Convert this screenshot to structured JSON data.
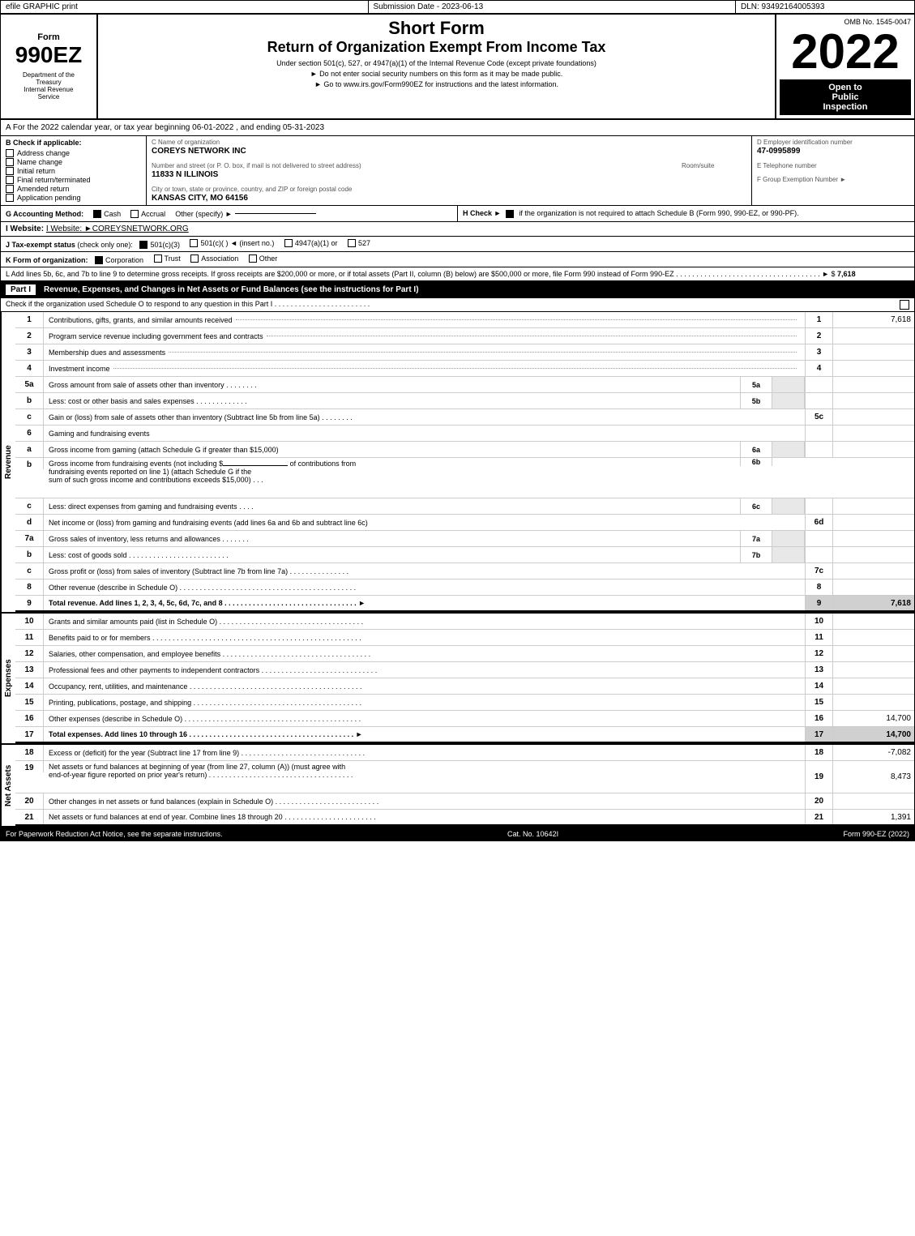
{
  "header": {
    "efile_label": "efile GRAPHIC print",
    "submission_label": "Submission Date - 2023-06-13",
    "dln_label": "DLN: 93492164005393"
  },
  "form": {
    "number": "990EZ",
    "dept_line1": "Department of the",
    "dept_line2": "Treasury",
    "dept_line3": "Internal Revenue",
    "dept_line4": "Service",
    "title1": "Short Form",
    "title2": "Return of Organization Exempt From Income Tax",
    "subtitle": "Under section 501(c), 527, or 4947(a)(1) of the Internal Revenue Code (except private foundations)",
    "instruction1": "► Do not enter social security numbers on this form as it may be made public.",
    "instruction2": "► Go to www.irs.gov/Form990EZ for instructions and the latest information.",
    "omb": "OMB No. 1545-0047",
    "year": "2022",
    "open_public": "Open to\nPublic\nInspection"
  },
  "section_a": {
    "label": "A  For the 2022 calendar year, or tax year beginning 06-01-2022 , and ending 05-31-2023"
  },
  "section_b": {
    "label": "B  Check if applicable:",
    "checkboxes": [
      {
        "id": "address_change",
        "label": "Address change",
        "checked": false
      },
      {
        "id": "name_change",
        "label": "Name change",
        "checked": false
      },
      {
        "id": "initial_return",
        "label": "Initial return",
        "checked": false
      },
      {
        "id": "final_return",
        "label": "Final return/terminated",
        "checked": false
      },
      {
        "id": "amended_return",
        "label": "Amended return",
        "checked": false
      },
      {
        "id": "application_pending",
        "label": "Application pending",
        "checked": false
      }
    ]
  },
  "section_c": {
    "name_label": "C Name of organization",
    "name_value": "COREYS NETWORK INC",
    "address_label": "Number and street (or P. O. box, if mail is not delivered to street address)",
    "address_value": "11833 N ILLINOIS",
    "room_label": "Room/suite",
    "room_value": "",
    "city_label": "City or town, state or province, country, and ZIP or foreign postal code",
    "city_value": "KANSAS CITY, MO  64156"
  },
  "section_d": {
    "label": "D Employer identification number",
    "value": "47-0995899",
    "tel_label": "E Telephone number",
    "tel_value": "",
    "group_label": "F Group Exemption",
    "group_sub": "Number  ►",
    "group_value": ""
  },
  "section_g": {
    "label": "G Accounting Method:",
    "cash_label": "Cash",
    "cash_checked": true,
    "accrual_label": "Accrual",
    "accrual_checked": false,
    "other_label": "Other (specify) ►",
    "other_value": ""
  },
  "section_h": {
    "label": "H  Check ►",
    "check_label": "if the organization is not required to attach Schedule B (Form 990, 990-EZ, or 990-PF).",
    "checked": true
  },
  "section_i": {
    "label": "I Website: ►COREYSNETWORK.ORG"
  },
  "section_j": {
    "label": "J Tax-exempt status (check only one):",
    "c3_checked": true,
    "c3_label": "501(c)(3)",
    "ct_checked": false,
    "ct_label": "501(c)(  )",
    "insert_label": "◄ (insert no.)",
    "c4947_checked": false,
    "c4947_label": "4947(a)(1) or",
    "c527_checked": false,
    "c527_label": "527"
  },
  "section_k": {
    "label": "K Form of organization:",
    "corp_checked": true,
    "corp_label": "Corporation",
    "trust_checked": false,
    "trust_label": "Trust",
    "assoc_checked": false,
    "assoc_label": "Association",
    "other_checked": false,
    "other_label": "Other"
  },
  "section_l": {
    "text": "L Add lines 5b, 6c, and 7b to line 9 to determine gross receipts. If gross receipts are $200,000 or more, or if total assets (Part II, column (B) below) are $500,000 or more, file Form 990 instead of Form 990-EZ . . . . . . . . . . . . . . . . . . . . . . . . . . . . . . . . . . . . ► $",
    "value": "7,618"
  },
  "part1": {
    "label": "Part I",
    "title": "Revenue, Expenses, and Changes in Net Assets or Fund Balances (see the instructions for Part I)",
    "check_note": "Check if the organization used Schedule O to respond to any question in this Part I . . . . . . . . . . . . . . . . . . . . . . . .",
    "rows": [
      {
        "num": "1",
        "desc": "Contributions, gifts, grants, and similar amounts received . . . . . . . . . . . . . . . . . . . . . . . . . . . . . . . .",
        "line": "1",
        "value": "7,618",
        "bold": false,
        "shaded": false
      },
      {
        "num": "2",
        "desc": "Program service revenue including government fees and contracts . . . . . . . . . . . . . . . . . . . . . . . . . . . . .",
        "line": "2",
        "value": "",
        "bold": false,
        "shaded": false
      },
      {
        "num": "3",
        "desc": "Membership dues and assessments . . . . . . . . . . . . . . . . . . . . . . . . . . . . . . . . . . . . . . . . . . . . . . . .",
        "line": "3",
        "value": "",
        "bold": false,
        "shaded": false
      },
      {
        "num": "4",
        "desc": "Investment income . . . . . . . . . . . . . . . . . . . . . . . . . . . . . . . . . . . . . . . . . . . . . . . . . . . . . . . . . . . .",
        "line": "4",
        "value": "",
        "bold": false,
        "shaded": false
      },
      {
        "num": "5a",
        "desc": "Gross amount from sale of assets other than inventory . . . . . . . .",
        "box_label": "5a",
        "line": "",
        "value": "",
        "has_box": true,
        "bold": false,
        "shaded": false
      },
      {
        "num": "b",
        "desc": "Less: cost or other basis and sales expenses . . . . . . . . . . . . .",
        "box_label": "5b",
        "line": "",
        "value": "",
        "has_box": true,
        "bold": false,
        "shaded": false
      },
      {
        "num": "c",
        "desc": "Gain or (loss) from sale of assets other than inventory (Subtract line 5b from line 5a) . . . . . . . .",
        "line": "5c",
        "value": "",
        "bold": false,
        "shaded": false
      },
      {
        "num": "6",
        "desc": "Gaming and fundraising events",
        "line": "",
        "value": "",
        "bold": false,
        "shaded": false,
        "no_dots": true
      },
      {
        "num": "a",
        "desc": "Gross income from gaming (attach Schedule G if greater than $15,000)",
        "box_label": "6a",
        "line": "",
        "value": "",
        "has_box": true,
        "bold": false,
        "shaded": false
      },
      {
        "num": "b",
        "desc": "Gross income from fundraising events (not including $________ of contributions from fundraising events reported on line 1) (attach Schedule G if the sum of such gross income and contributions exceeds $15,000) . . .",
        "box_label": "6b",
        "line": "",
        "value": "",
        "has_box": true,
        "bold": false,
        "shaded": false,
        "multiline": true
      },
      {
        "num": "c",
        "desc": "Less: direct expenses from gaming and fundraising events . . . .",
        "box_label": "6c",
        "line": "",
        "value": "",
        "has_box": true,
        "bold": false,
        "shaded": false
      },
      {
        "num": "d",
        "desc": "Net income or (loss) from gaming and fundraising events (add lines 6a and 6b and subtract line 6c)",
        "line": "6d",
        "value": "",
        "bold": false,
        "shaded": false
      },
      {
        "num": "7a",
        "desc": "Gross sales of inventory, less returns and allowances . . . . . . .",
        "box_label": "7a",
        "line": "",
        "value": "",
        "has_box": true,
        "bold": false,
        "shaded": false
      },
      {
        "num": "b",
        "desc": "Less: cost of goods sold . . . . . . . . . . . . . . . . . . . . . . . . . .",
        "box_label": "7b",
        "line": "",
        "value": "",
        "has_box": true,
        "bold": false,
        "shaded": false
      },
      {
        "num": "c",
        "desc": "Gross profit or (loss) from sales of inventory (Subtract line 7b from line 7a) . . . . . . . . . . . . . . .",
        "line": "7c",
        "value": "",
        "bold": false,
        "shaded": false
      },
      {
        "num": "8",
        "desc": "Other revenue (describe in Schedule O) . . . . . . . . . . . . . . . . . . . . . . . . . . . . . . . . . . . . . . . . . . . . .",
        "line": "8",
        "value": "",
        "bold": false,
        "shaded": false
      },
      {
        "num": "9",
        "desc": "Total revenue. Add lines 1, 2, 3, 4, 5c, 6d, 7c, and 8 . . . . . . . . . . . . . . . . . . . . . . . . . . . . . . . . . ►",
        "line": "9",
        "value": "7,618",
        "bold": true,
        "shaded": true
      }
    ],
    "expenses_rows": [
      {
        "num": "10",
        "desc": "Grants and similar amounts paid (list in Schedule O) . . . . . . . . . . . . . . . . . . . . . . . . . . . . . . . . . . . .",
        "line": "10",
        "value": "",
        "bold": false,
        "shaded": false
      },
      {
        "num": "11",
        "desc": "Benefits paid to or for members . . . . . . . . . . . . . . . . . . . . . . . . . . . . . . . . . . . . . . . . . . . . . . . . . . . .",
        "line": "11",
        "value": "",
        "bold": false,
        "shaded": false
      },
      {
        "num": "12",
        "desc": "Salaries, other compensation, and employee benefits . . . . . . . . . . . . . . . . . . . . . . . . . . . . . . . . . . . . .",
        "line": "12",
        "value": "",
        "bold": false,
        "shaded": false
      },
      {
        "num": "13",
        "desc": "Professional fees and other payments to independent contractors . . . . . . . . . . . . . . . . . . . . . . . . . . . . .",
        "line": "13",
        "value": "",
        "bold": false,
        "shaded": false
      },
      {
        "num": "14",
        "desc": "Occupancy, rent, utilities, and maintenance . . . . . . . . . . . . . . . . . . . . . . . . . . . . . . . . . . . . . . . . . . .",
        "line": "14",
        "value": "",
        "bold": false,
        "shaded": false
      },
      {
        "num": "15",
        "desc": "Printing, publications, postage, and shipping . . . . . . . . . . . . . . . . . . . . . . . . . . . . . . . . . . . . . . . . . .",
        "line": "15",
        "value": "",
        "bold": false,
        "shaded": false
      },
      {
        "num": "16",
        "desc": "Other expenses (describe in Schedule O) . . . . . . . . . . . . . . . . . . . . . . . . . . . . . . . . . . . . . . . . . . . .",
        "line": "16",
        "value": "14,700",
        "bold": false,
        "shaded": false
      },
      {
        "num": "17",
        "desc": "Total expenses. Add lines 10 through 16 . . . . . . . . . . . . . . . . . . . . . . . . . . . . . . . . . . . . . . . . . ►",
        "line": "17",
        "value": "14,700",
        "bold": true,
        "shaded": true
      }
    ],
    "netassets_rows": [
      {
        "num": "18",
        "desc": "Excess or (deficit) for the year (Subtract line 17 from line 9) . . . . . . . . . . . . . . . . . . . . . . . . . . . . . . .",
        "line": "18",
        "value": "-7,082",
        "bold": false,
        "shaded": false
      },
      {
        "num": "19",
        "desc": "Net assets or fund balances at beginning of year (from line 27, column (A)) (must agree with end-of-year figure reported on prior year's return) . . . . . . . . . . . . . . . . . . . . . . . . . . . . . . . . . . . .",
        "line": "19",
        "value": "8,473",
        "bold": false,
        "shaded": false,
        "multiline": true
      },
      {
        "num": "20",
        "desc": "Other changes in net assets or fund balances (explain in Schedule O) . . . . . . . . . . . . . . . . . . . . . . . . . .",
        "line": "20",
        "value": "",
        "bold": false,
        "shaded": false
      },
      {
        "num": "21",
        "desc": "Net assets or fund balances at end of year. Combine lines 18 through 20 . . . . . . . . . . . . . . . . . . . . . . .",
        "line": "21",
        "value": "1,391",
        "bold": false,
        "shaded": false
      }
    ]
  },
  "footer": {
    "paperwork": "For Paperwork Reduction Act Notice, see the separate instructions.",
    "cat": "Cat. No. 10642I",
    "form_ref": "Form 990-EZ (2022)"
  }
}
